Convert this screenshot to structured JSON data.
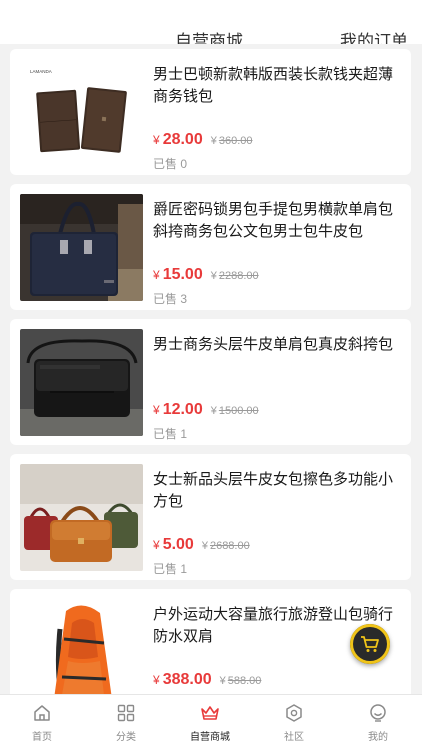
{
  "header": {
    "tabs": [
      {
        "label": "自营商城"
      },
      {
        "label": "我的订单"
      }
    ]
  },
  "products": [
    {
      "title": "男士巴顿新款韩版西装长款钱夹超薄商务钱包",
      "currency": "¥",
      "price": "28.00",
      "original_price": "360.00",
      "sold": "已售 0",
      "brand_mark": "LAMANDA"
    },
    {
      "title": "爵匠密码锁男包手提包男横款单肩包斜挎商务包公文包男士包牛皮包",
      "currency": "¥",
      "price": "15.00",
      "original_price": "2288.00",
      "sold": "已售 3"
    },
    {
      "title": "男士商务头层牛皮单肩包真皮斜挎包",
      "currency": "¥",
      "price": "12.00",
      "original_price": "1500.00",
      "sold": "已售 1"
    },
    {
      "title": "女士新品头层牛皮女包擦色多功能小方包",
      "currency": "¥",
      "price": "5.00",
      "original_price": "2688.00",
      "sold": "已售 1"
    },
    {
      "title": "户外运动大容量旅行旅游登山包骑行防水双肩",
      "currency": "¥",
      "price": "388.00",
      "original_price": "588.00",
      "sold": ""
    }
  ],
  "cart_button": {
    "icon": "shopping-cart-icon"
  },
  "tabbar": {
    "active_index": 2,
    "accent_color": "#e83a3a",
    "items": [
      {
        "label": "首页",
        "icon": "home-icon"
      },
      {
        "label": "分类",
        "icon": "category-grid-icon"
      },
      {
        "label": "自营商城",
        "icon": "crown-icon"
      },
      {
        "label": "社区",
        "icon": "community-icon"
      },
      {
        "label": "我的",
        "icon": "profile-icon"
      }
    ]
  }
}
